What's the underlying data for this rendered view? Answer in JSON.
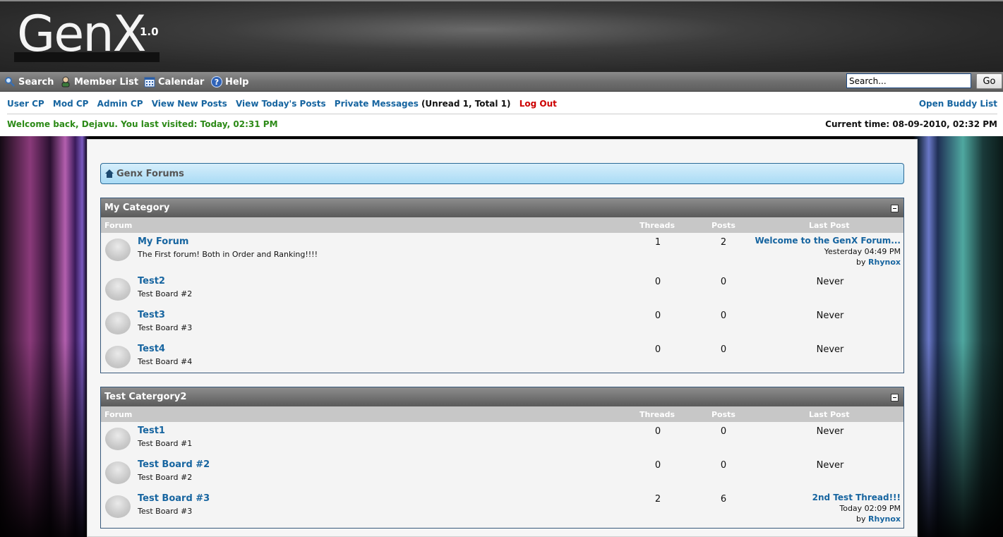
{
  "logo": {
    "text": "GenX",
    "version": "1.0"
  },
  "nav": {
    "items": [
      {
        "label": "Search",
        "icon": "search-icon"
      },
      {
        "label": "Member List",
        "icon": "member-list-icon"
      },
      {
        "label": "Calendar",
        "icon": "calendar-icon"
      },
      {
        "label": "Help",
        "icon": "help-icon"
      }
    ],
    "search_value": "Search...",
    "go_label": "Go"
  },
  "links": {
    "user_cp": "User CP",
    "mod_cp": "Mod CP",
    "admin_cp": "Admin CP",
    "view_new": "View New Posts",
    "view_today": "View Today's Posts",
    "pm": "Private Messages",
    "pm_count": "(Unread 1, Total 1)",
    "logout": "Log Out",
    "buddy": "Open Buddy List",
    "welcome": "Welcome back, Dejavu. You last visited: Today, 02:31 PM",
    "current_time": "Current time: 08-09-2010, 02:32 PM"
  },
  "breadcrumb": "Genx Forums",
  "columns": {
    "forum": "Forum",
    "threads": "Threads",
    "posts": "Posts",
    "last_post": "Last Post"
  },
  "categories": [
    {
      "title": "My Category",
      "forums": [
        {
          "name": "My Forum",
          "desc": "The First forum! Both in Order and Ranking!!!!",
          "threads": "1",
          "posts": "2",
          "last_title": "Welcome to the GenX Forum...",
          "last_date": "Yesterday 04:49 PM",
          "last_by_prefix": "by",
          "last_by": "Rhynox"
        },
        {
          "name": "Test2",
          "desc": "Test Board #2",
          "threads": "0",
          "posts": "0",
          "never": "Never"
        },
        {
          "name": "Test3",
          "desc": "Test Board #3",
          "threads": "0",
          "posts": "0",
          "never": "Never"
        },
        {
          "name": "Test4",
          "desc": "Test Board #4",
          "threads": "0",
          "posts": "0",
          "never": "Never"
        }
      ]
    },
    {
      "title": "Test Catergory2",
      "forums": [
        {
          "name": "Test1",
          "desc": "Test Board #1",
          "threads": "0",
          "posts": "0",
          "never": "Never"
        },
        {
          "name": "Test Board #2",
          "desc": "Test Board #2",
          "threads": "0",
          "posts": "0",
          "never": "Never"
        },
        {
          "name": "Test Board #3",
          "desc": "Test Board #3",
          "threads": "2",
          "posts": "6",
          "last_title": "2nd Test Thread!!!",
          "last_date": "Today 02:09 PM",
          "last_by_prefix": "by",
          "last_by": "Rhynox"
        }
      ]
    }
  ],
  "colors": {
    "link": "#1765a0",
    "welcome": "#2c8a17",
    "logout": "#cc0000",
    "breadcrumb_bg": "#a9dbf5"
  }
}
